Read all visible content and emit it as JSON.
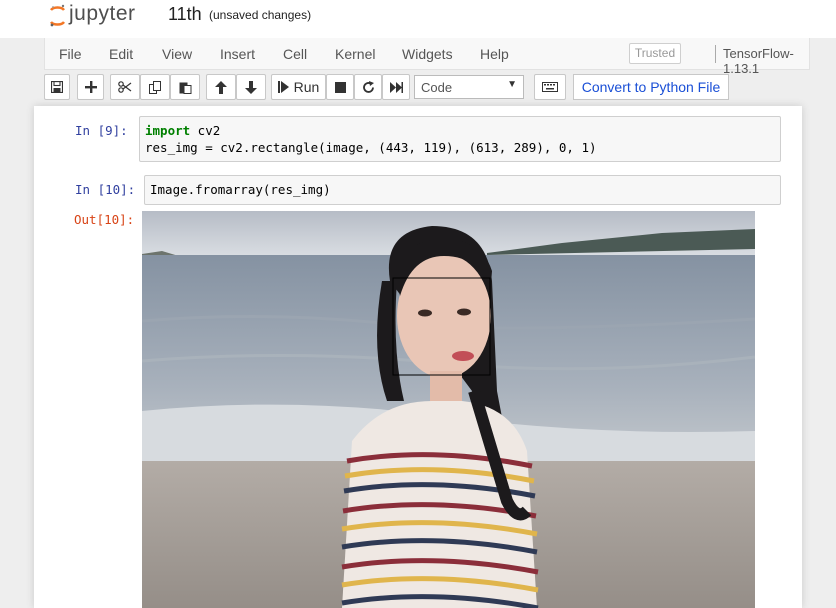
{
  "header": {
    "logo_text": "jupyter",
    "notebook_name": "11th",
    "save_status": "(unsaved changes)"
  },
  "menubar": {
    "items": [
      "File",
      "Edit",
      "View",
      "Insert",
      "Cell",
      "Kernel",
      "Widgets",
      "Help"
    ],
    "trusted": "Trusted",
    "kernel_name": "TensorFlow-1.13.1"
  },
  "toolbar": {
    "run_label": "Run",
    "cell_type": "Code",
    "convert_label": "Convert to Python File",
    "buttons": [
      "save-icon",
      "plus-icon",
      "scissors-icon",
      "copy-icon",
      "paste-icon",
      "arrow-up-icon",
      "arrow-down-icon",
      "run-icon",
      "stop-icon",
      "restart-icon",
      "fast-forward-icon",
      "keyboard-icon"
    ]
  },
  "cells": [
    {
      "prompt": "In [9]:",
      "line1_keyword": "import",
      "line1_rest": " cv2",
      "line2": "res_img = cv2.rectangle(image, (443, 119), (613, 289), 0, 1)"
    },
    {
      "prompt": "In [10]:",
      "line1": "Image.fromarray(res_img)"
    }
  ],
  "output": {
    "prompt": "Out[10]:",
    "image_description_icon": "photo-output-image"
  },
  "colors": {
    "in_prompt": "#303f9f",
    "out_prompt": "#d84315",
    "keyword": "#008000",
    "convert_link": "#1a4fd6"
  }
}
